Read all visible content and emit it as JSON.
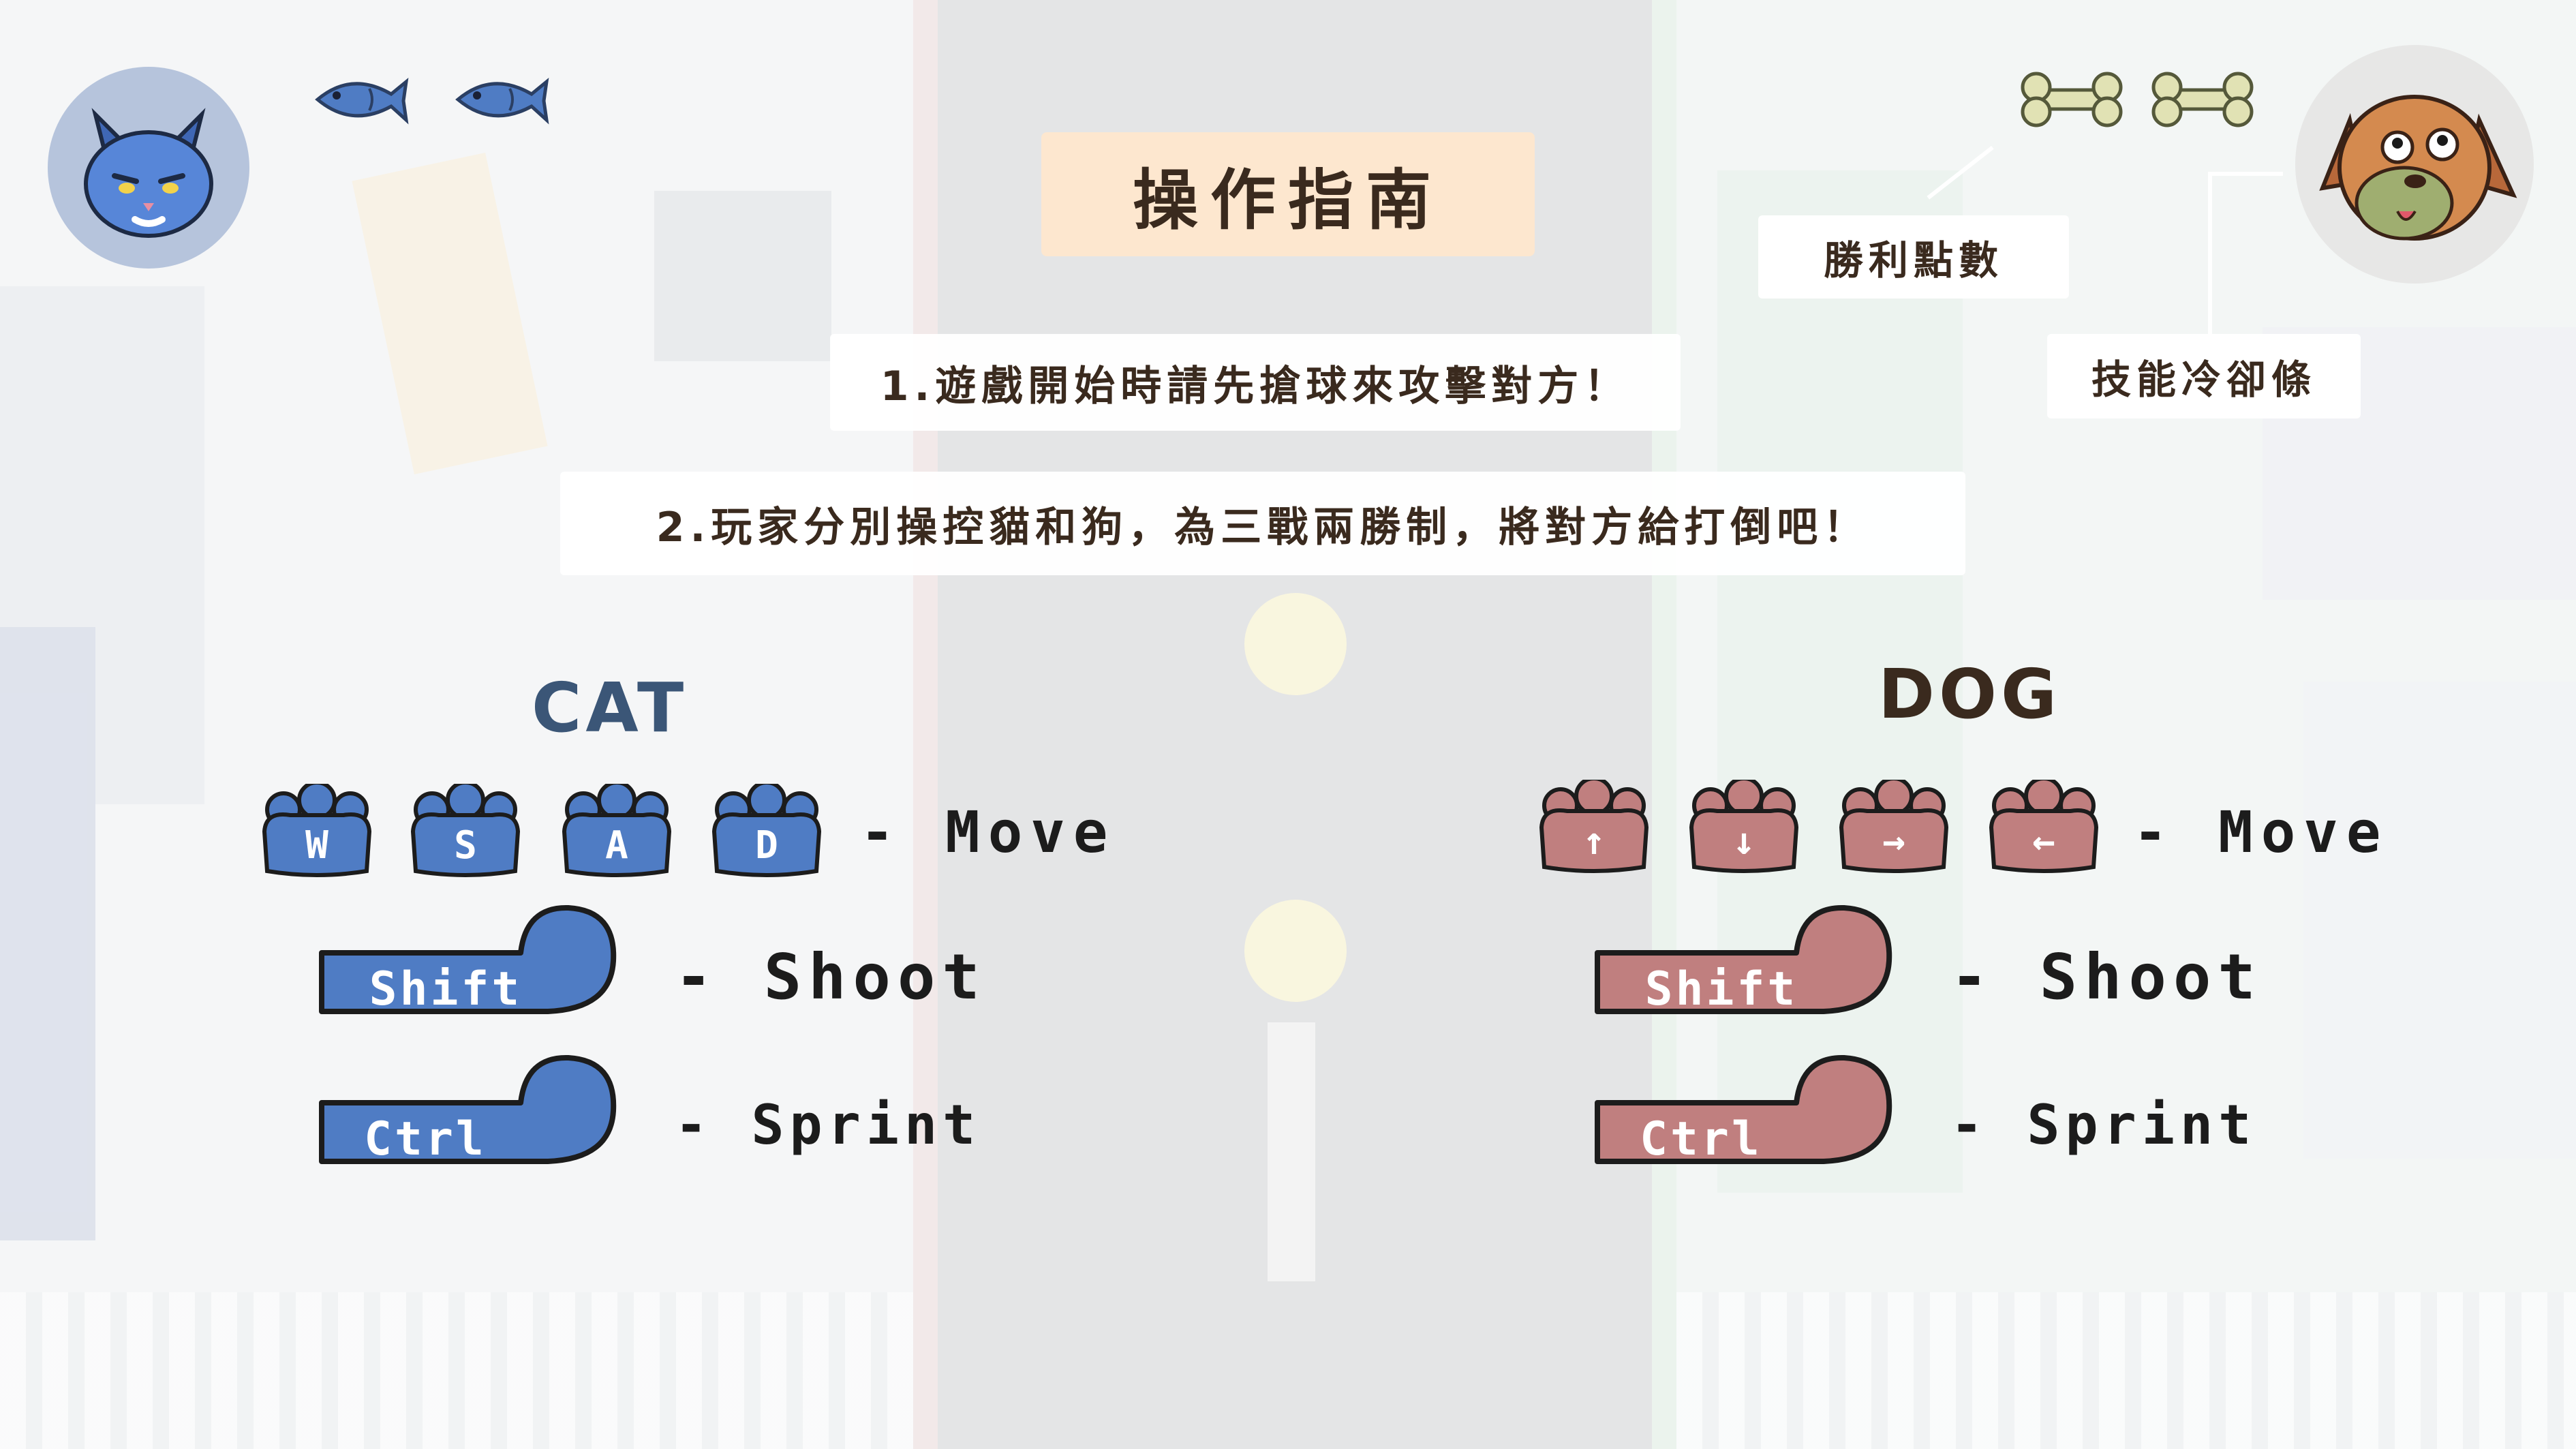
{
  "title": "操作指南",
  "rules": [
    "1.遊戲開始時請先搶球來攻擊對方！",
    "2.玩家分別操控貓和狗，為三戰兩勝制，將對方給打倒吧！"
  ],
  "hud": {
    "cat_avatar_icon": "cat-face-icon",
    "dog_avatar_icon": "dog-face-icon",
    "fish_icon": "fish-icon",
    "bone_icon": "bone-icon",
    "cat_fish_count": 2,
    "dog_bone_count": 2,
    "score_label": "勝利點數",
    "cooldown_label": "技能冷卻條"
  },
  "colors": {
    "cat_blue": "#4f7cc4",
    "dog_red": "#c07f7f",
    "title_bg": "#fde7cf",
    "text_dark": "#3a2a1e"
  },
  "cat": {
    "heading": "CAT",
    "move_keys": [
      "W",
      "S",
      "A",
      "D"
    ],
    "move_action": "- Move",
    "shoot_key": "Shift",
    "shoot_action": "- Shoot",
    "sprint_key": "Ctrl",
    "sprint_action": "- Sprint"
  },
  "dog": {
    "heading": "DOG",
    "move_keys": [
      "↑",
      "↓",
      "→",
      "←"
    ],
    "move_action": "- Move",
    "shoot_key": "Shift",
    "shoot_action": "- Shoot",
    "sprint_key": "Ctrl",
    "sprint_action": "- Sprint"
  }
}
